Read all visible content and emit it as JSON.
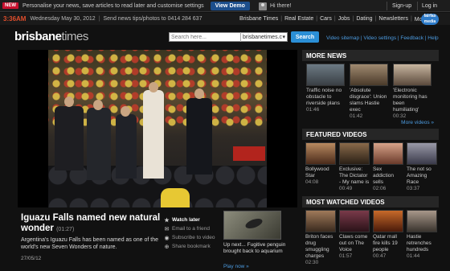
{
  "promo": {
    "badge": "NEW",
    "text": "Personalise your news, save articles to read later and customise settings",
    "demo_button": "View Demo",
    "greeting": "Hi there!",
    "signup": "Sign-up",
    "login": "Log in"
  },
  "header": {
    "time": "3:36AM",
    "date": "Wednesday May 30, 2012",
    "send_tips": "Send news tips/photos to 0414 284 637",
    "nav": [
      "Brisbane Times",
      "Real Estate",
      "Cars",
      "Jobs",
      "Dating",
      "Newsletters",
      "More"
    ],
    "fairfax": "fairfax media"
  },
  "logo": {
    "brisbane": "brisbane",
    "times": "times"
  },
  "search": {
    "placeholder": "Search here...",
    "scope": "brisbanetimes.c",
    "button": "Search"
  },
  "top_links": [
    "Video sitemap",
    "Video settings",
    "Feedback",
    "Help"
  ],
  "article": {
    "title": "Iguazu Falls named new natural wonder",
    "duration": "(01:27)",
    "description": "Argentina's Iguazu Falls has been named as one of the world's new Seven Wonders of nature.",
    "date": "27/05/12",
    "actions": [
      "Watch later",
      "Email to a friend",
      "Subscribe to video",
      "Share bookmark"
    ]
  },
  "up_next": {
    "text": "Up next... Fugitive penguin brought back to aquarium",
    "play_now": "Play now »"
  },
  "sidebar": {
    "more_news": {
      "title": "MORE NEWS",
      "items": [
        {
          "caption": "Traffic noise no obstacle to riverside plans",
          "duration": "01:46"
        },
        {
          "caption": "'Absolute disgrace': Union slams Hastie exec",
          "duration": "01:42"
        },
        {
          "caption": "'Electronic monitoring has been humiliating'",
          "duration": "00:32"
        }
      ],
      "more_link": "More videos »"
    },
    "featured": {
      "title": "FEATURED VIDEOS",
      "items": [
        {
          "caption": "Bollywood Star",
          "duration": "04:08"
        },
        {
          "caption": "Exclusive: The Dictator - My name is",
          "duration": "00:49"
        },
        {
          "caption": "Sex addiction sells",
          "duration": "02:06"
        },
        {
          "caption": "The not so Amazing Race",
          "duration": "03:37"
        }
      ]
    },
    "most_watched": {
      "title": "MOST WATCHED VIDEOS",
      "items": [
        {
          "caption": "Briton faces drug smuggling charges",
          "duration": "02:30"
        },
        {
          "caption": "Claws come out on The Voice",
          "duration": "01:57"
        },
        {
          "caption": "Qatar mall fire kills 19 people",
          "duration": "00:47"
        },
        {
          "caption": "Hastie retrenches hundreds",
          "duration": "01:44"
        }
      ]
    }
  }
}
